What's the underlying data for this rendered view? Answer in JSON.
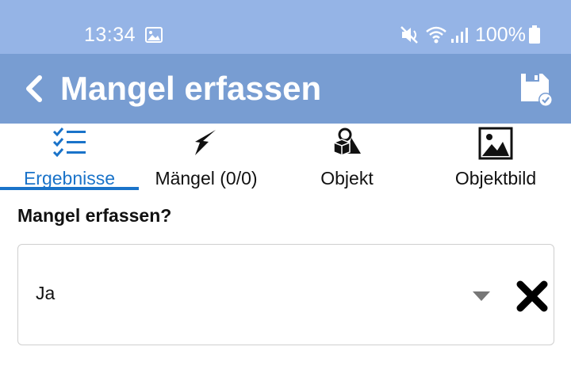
{
  "status_bar": {
    "time": "13:34",
    "battery": "100%",
    "icons": [
      "gallery-icon",
      "mute-icon",
      "wifi-icon",
      "signal-icon",
      "battery-icon"
    ]
  },
  "app_bar": {
    "title": "Mangel erfassen",
    "back_icon": "chevron-left-icon",
    "save_icon": "save-check-icon"
  },
  "tabs": [
    {
      "label": "Ergebnisse",
      "icon": "checklist-icon",
      "active": true
    },
    {
      "label": "Mängel (0/0)",
      "icon": "lightning-icon",
      "active": false
    },
    {
      "label": "Objekt",
      "icon": "shapes-icon",
      "active": false
    },
    {
      "label": "Objektbild",
      "icon": "image-icon",
      "active": false
    }
  ],
  "form": {
    "question": "Mangel erfassen?",
    "selected_value": "Ja"
  },
  "colors": {
    "status_bar_bg": "#95b4e6",
    "app_bar_bg": "#789dd2",
    "accent": "#1a73c9"
  }
}
